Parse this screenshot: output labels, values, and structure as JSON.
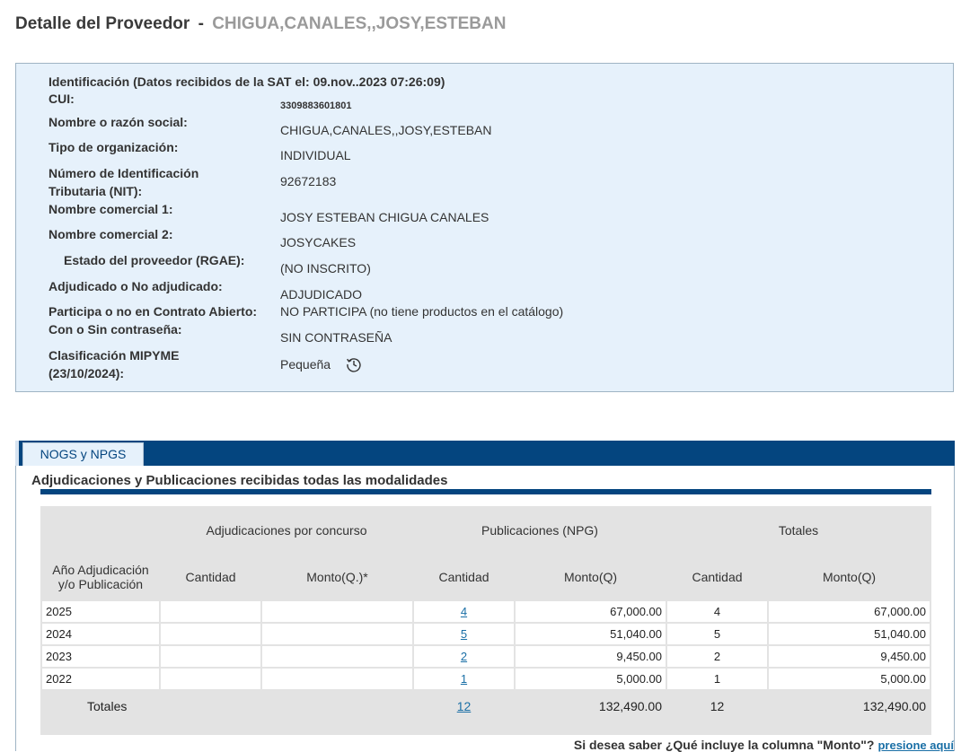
{
  "header": {
    "title": "Detalle del Proveedor",
    "separator": "-",
    "provider": "CHIGUA,CANALES,,JOSY,ESTEBAN"
  },
  "info": {
    "identification_heading": "Identificación (Datos recibidos de la SAT el: 09.nov..2023 07:26:09)",
    "fields": [
      {
        "label": "CUI:",
        "value": "3309883601801"
      },
      {
        "label": "Nombre o razón social:",
        "value": "CHIGUA,CANALES,,JOSY,ESTEBAN"
      },
      {
        "label": "Tipo de organización:",
        "value": "INDIVIDUAL"
      },
      {
        "label": "Número de Identificación",
        "label2": "Tributaria (NIT):",
        "value": "92672183"
      },
      {
        "label": "Nombre comercial 1:",
        "value": "JOSY ESTEBAN CHIGUA CANALES"
      },
      {
        "label": "Nombre comercial 2:",
        "value": "JOSYCAKES"
      },
      {
        "label": "Estado del proveedor (RGAE):",
        "value": "(NO INSCRITO)"
      },
      {
        "label": "Adjudicado o No adjudicado:",
        "value": "ADJUDICADO"
      },
      {
        "label": "Participa o no en Contrato Abierto:",
        "value": "NO PARTICIPA (no tiene productos en el catálogo)"
      },
      {
        "label": "Con o Sin contraseña:",
        "value": "SIN CONTRASEÑA"
      },
      {
        "label": "Clasificación MIPYME",
        "label2": "(23/10/2024):",
        "value": "Pequeña"
      }
    ]
  },
  "tabs": [
    {
      "label": "NOGS y NPGS"
    }
  ],
  "section": {
    "title": "Adjudicaciones y Publicaciones recibidas todas las modalidades",
    "group_headers": [
      "Adjudicaciones por concurso",
      "Publicaciones (NPG)",
      "Totales"
    ],
    "col_headers": [
      "Año Adjudicación y/o Publicación",
      "Cantidad",
      "Monto(Q.)*",
      "Cantidad",
      "Monto(Q)",
      "Cantidad",
      "Monto(Q)"
    ],
    "rows": [
      {
        "year": "2025",
        "adj_qty": "",
        "adj_amt": "",
        "pub_qty": "4",
        "pub_amt": "67,000.00",
        "tot_qty": "4",
        "tot_amt": "67,000.00"
      },
      {
        "year": "2024",
        "adj_qty": "",
        "adj_amt": "",
        "pub_qty": "5",
        "pub_amt": "51,040.00",
        "tot_qty": "5",
        "tot_amt": "51,040.00"
      },
      {
        "year": "2023",
        "adj_qty": "",
        "adj_amt": "",
        "pub_qty": "2",
        "pub_amt": "9,450.00",
        "tot_qty": "2",
        "tot_amt": "9,450.00"
      },
      {
        "year": "2022",
        "adj_qty": "",
        "adj_amt": "",
        "pub_qty": "1",
        "pub_amt": "5,000.00",
        "tot_qty": "1",
        "tot_amt": "5,000.00"
      }
    ],
    "totals": {
      "label": "Totales",
      "pub_qty": "12",
      "pub_amt": "132,490.00",
      "tot_qty": "12",
      "tot_amt": "132,490.00"
    }
  },
  "footer": {
    "question": "Si desea saber ¿Qué incluye la columna \"Monto\"?",
    "link": "presione aquí"
  }
}
